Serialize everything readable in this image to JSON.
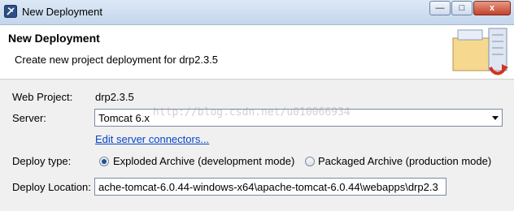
{
  "window": {
    "title": "New Deployment",
    "controls": {
      "minimize": "—",
      "maximize": "□",
      "close": "x"
    }
  },
  "header": {
    "title": "New Deployment",
    "description": "Create new project deployment for drp2.3.5"
  },
  "form": {
    "web_project": {
      "label": "Web Project:",
      "value": "drp2.3.5"
    },
    "server": {
      "label": "Server:",
      "selected": "Tomcat  6.x"
    },
    "edit_link": "Edit server connectors...",
    "deploy_type": {
      "label": "Deploy type:",
      "options": [
        {
          "label": "Exploded Archive (development mode)",
          "checked": true
        },
        {
          "label": "Packaged Archive (production mode)",
          "checked": false
        }
      ]
    },
    "deploy_location": {
      "label": "Deploy Location:",
      "value": "ache-tomcat-6.0.44-windows-x64\\apache-tomcat-6.0.44\\webapps\\drp2.3"
    }
  },
  "watermark": "http://blog.csdn.net/u010066934"
}
